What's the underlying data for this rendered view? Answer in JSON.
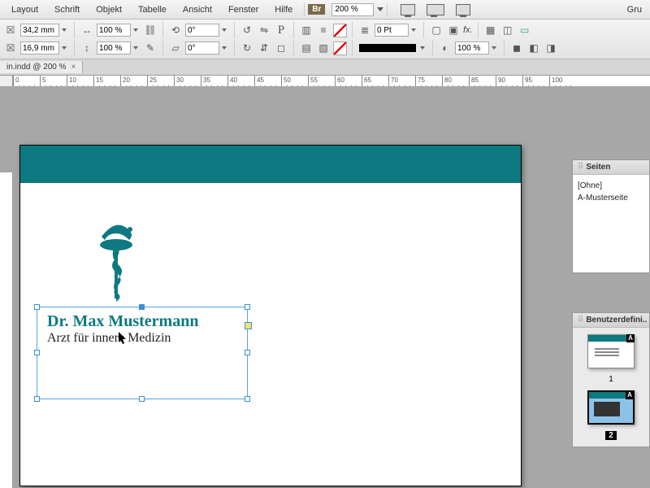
{
  "menu": {
    "items": [
      "Layout",
      "Schrift",
      "Objekt",
      "Tabelle",
      "Ansicht",
      "Fenster",
      "Hilfe"
    ],
    "brBadge": "Br",
    "zoom": "200 %",
    "rightLabel": "Gru"
  },
  "control": {
    "x": "34,2 mm",
    "y": "16,9 mm",
    "scaleX": "100 %",
    "scaleY": "100 %",
    "rotate": "0°",
    "shear": "0°",
    "strokeWeight": "0 Pt",
    "opacity": "100 %",
    "fxLabel": "fx.",
    "pChar": "P"
  },
  "doc": {
    "tab": "in.indd @ 200 %"
  },
  "ruler": {
    "labels": [
      "0",
      "5",
      "10",
      "15",
      "20",
      "25",
      "30",
      "35",
      "40",
      "45",
      "50",
      "55",
      "60",
      "65",
      "70",
      "75",
      "80",
      "85",
      "90",
      "95",
      "100"
    ]
  },
  "artwork": {
    "title": "Dr. Max Mustermann",
    "sub": "Arzt für innere Medizin"
  },
  "panels": {
    "pages": {
      "title": "Seiten",
      "none": "[Ohne]",
      "master": "A-Musterseite",
      "fold": "A",
      "num1": "1",
      "num2": "2"
    },
    "custom": {
      "title": "Benutzerdefini.."
    }
  }
}
